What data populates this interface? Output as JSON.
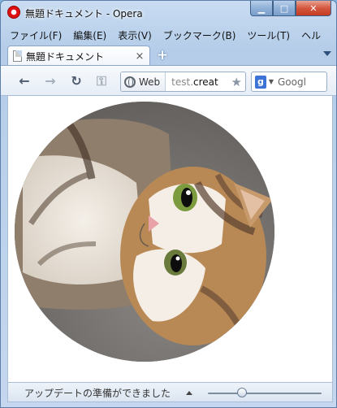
{
  "window": {
    "title": "無題ドキュメント - Opera",
    "minimize_symbol": "▁",
    "maximize_symbol": "□",
    "close_symbol": "✕"
  },
  "menu": {
    "items": [
      {
        "label": "ファイル(F)"
      },
      {
        "label": "編集(E)"
      },
      {
        "label": "表示(V)"
      },
      {
        "label": "ブックマーク(B)"
      },
      {
        "label": "ツール(T)"
      },
      {
        "label": "ヘル"
      }
    ]
  },
  "tabs": {
    "active": {
      "label": "無題ドキュメント",
      "close_symbol": "×"
    },
    "new_tab_symbol": "+"
  },
  "toolbar": {
    "back_symbol": "←",
    "forward_symbol": "→",
    "reload_symbol": "↻",
    "key_symbol": "⚿"
  },
  "address": {
    "badge": "Web",
    "url_prefix": "test.",
    "url_domain": "creat",
    "star_symbol": "★"
  },
  "search": {
    "engine_letter": "g",
    "dropdown_symbol": "▼",
    "value": "Googl"
  },
  "content": {
    "image_subject": "cat-photo-circle"
  },
  "status": {
    "text": "アップデートの準備ができました",
    "zoom_fraction": 0.3
  },
  "colors": {
    "title_bar": "#c9dcf2",
    "close_button": "#c33b22",
    "content_bg": "#ffffff"
  }
}
